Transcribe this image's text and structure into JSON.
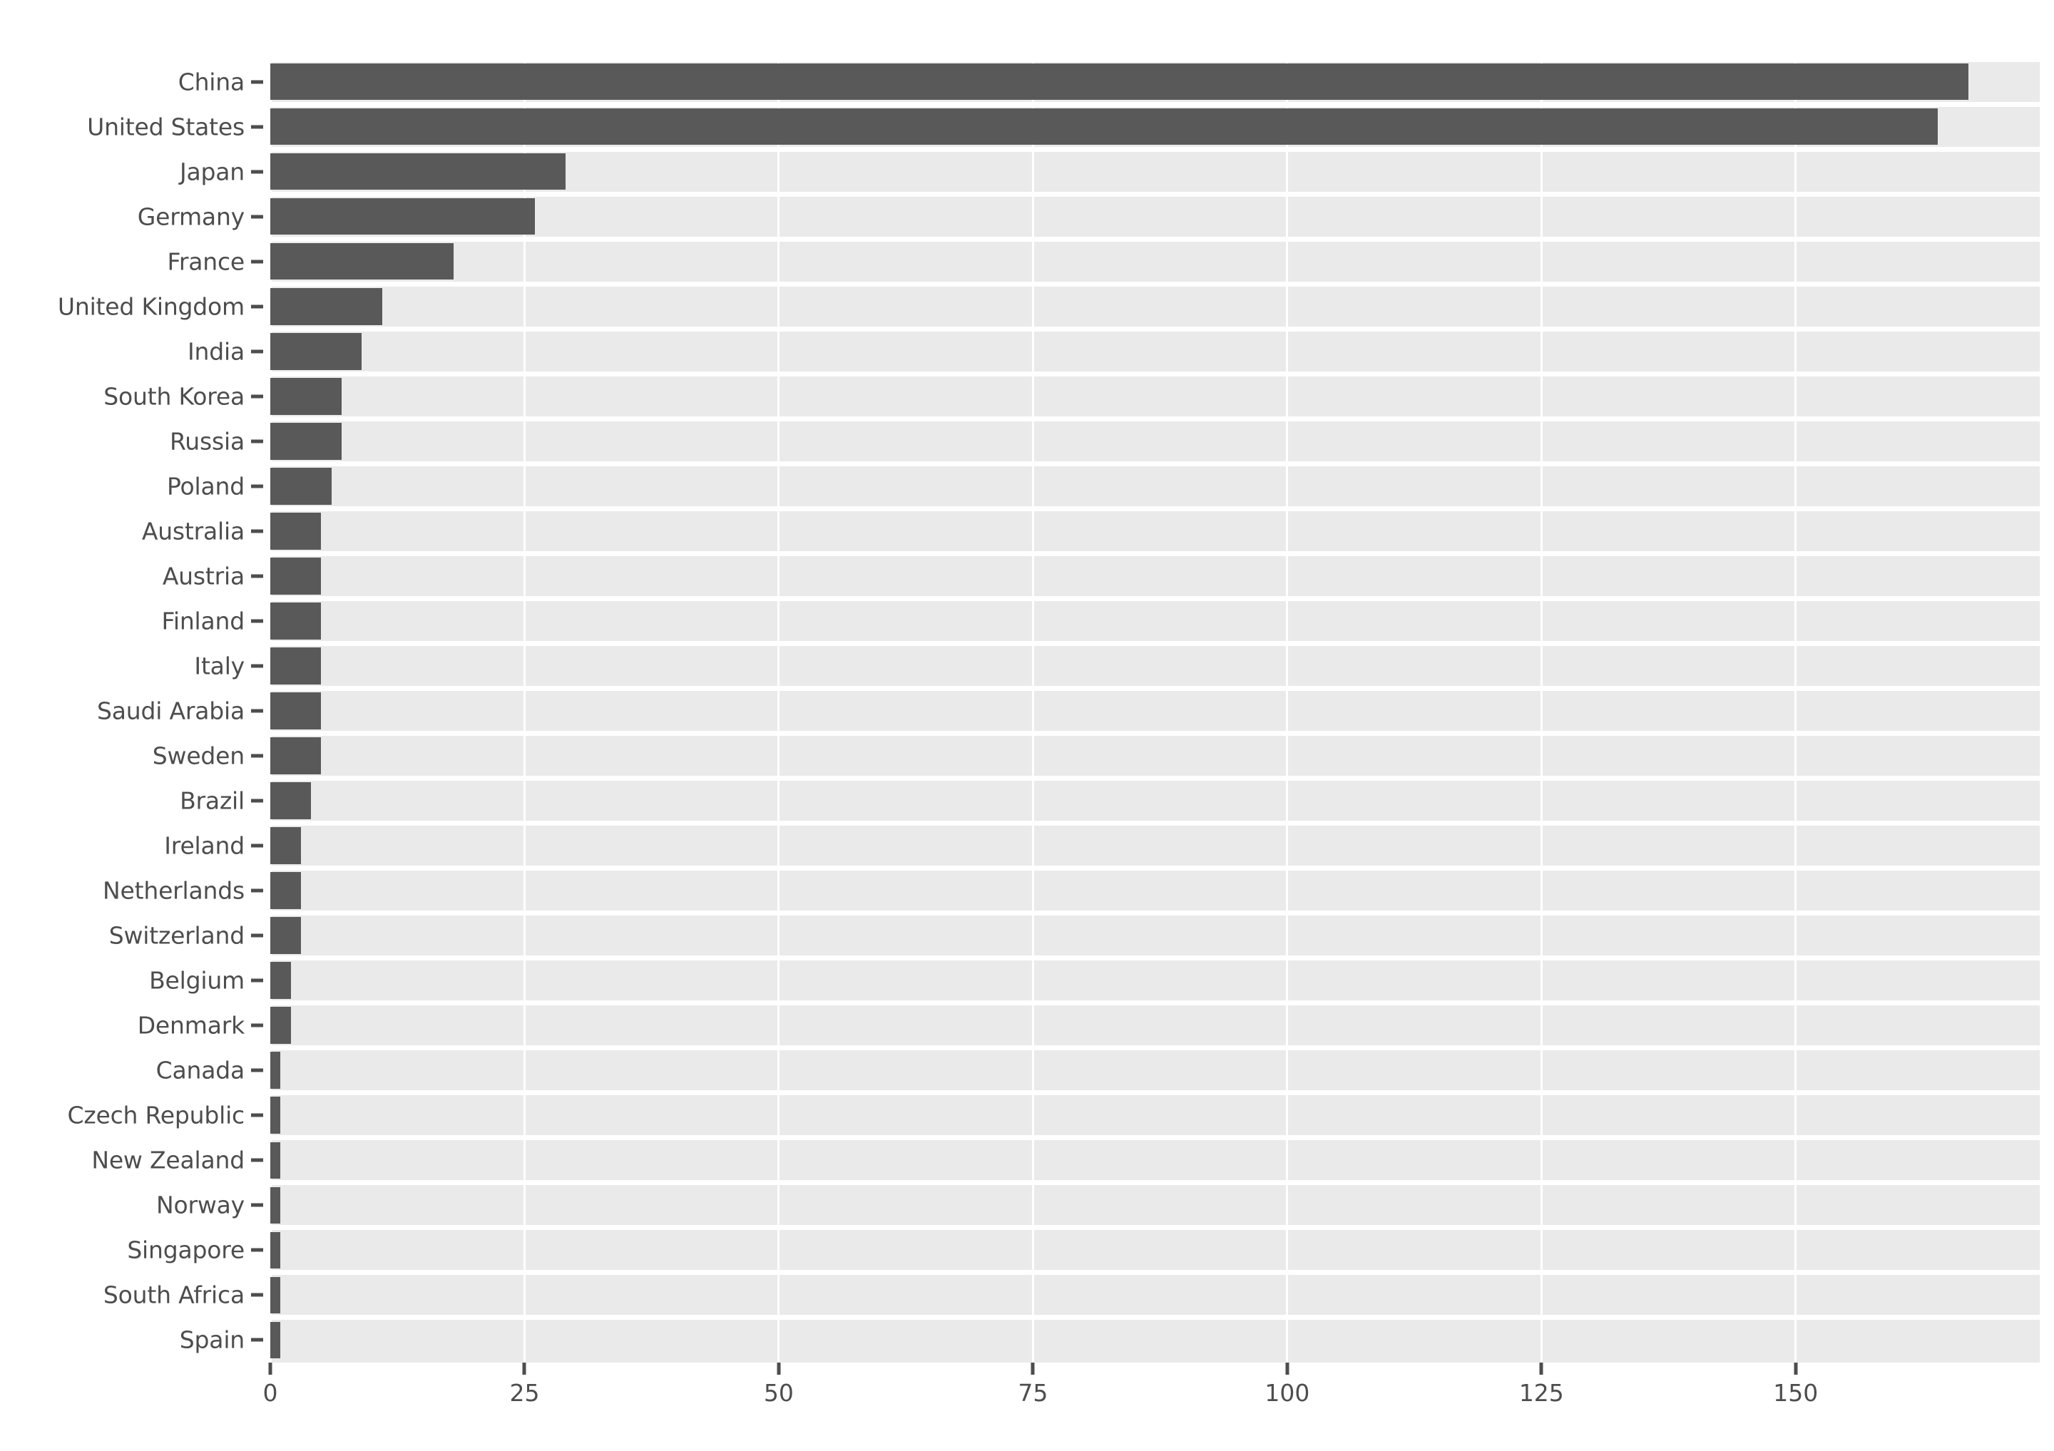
{
  "chart_data": {
    "type": "bar",
    "orientation": "horizontal",
    "title": "",
    "subtitle": "",
    "xlabel": "",
    "ylabel": "",
    "categories": [
      "China",
      "United States",
      "Japan",
      "Germany",
      "France",
      "United Kingdom",
      "India",
      "South Korea",
      "Russia",
      "Poland",
      "Australia",
      "Austria",
      "Finland",
      "Italy",
      "Saudi Arabia",
      "Sweden",
      "Brazil",
      "Ireland",
      "Netherlands",
      "Switzerland",
      "Belgium",
      "Denmark",
      "Canada",
      "Czech Republic",
      "New Zealand",
      "Norway",
      "Singapore",
      "South Africa",
      "Spain"
    ],
    "values": [
      167,
      164,
      29,
      26,
      18,
      11,
      9,
      7,
      7,
      6,
      5,
      5,
      5,
      5,
      5,
      5,
      4,
      3,
      3,
      3,
      2,
      2,
      1,
      1,
      1,
      1,
      1,
      1,
      1
    ],
    "xticks": [
      0,
      25,
      50,
      75,
      100,
      125,
      150
    ],
    "xtick_labels": [
      "0",
      "25",
      "50",
      "75",
      "100",
      "125",
      "150"
    ],
    "xlim": [
      0,
      174
    ],
    "grid": "vertical",
    "legend": "none",
    "bar_color": "#595959",
    "plot_background": "#eaeaea",
    "figure_background": "#ffffff",
    "grid_color": "#ffffff",
    "tick_color": "#4d4d4d"
  }
}
